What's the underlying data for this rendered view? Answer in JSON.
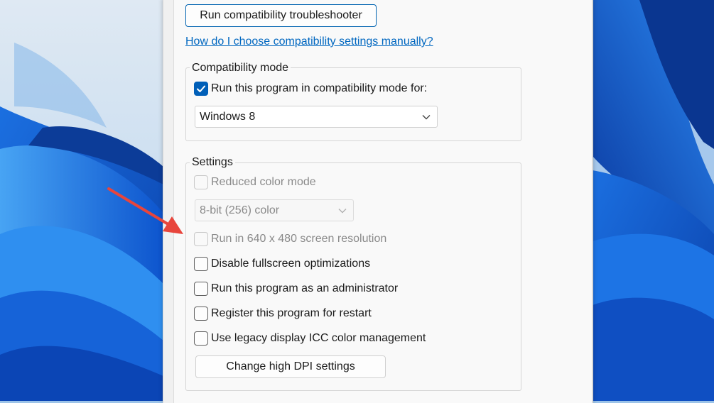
{
  "troubleshooter_button": "Run compatibility troubleshooter",
  "help_link": "How do I choose compatibility settings manually?",
  "compat_group": {
    "legend": "Compatibility mode",
    "checkbox_label": "Run this program in compatibility mode for:",
    "checked": true,
    "selected_os": "Windows 8"
  },
  "settings_group": {
    "legend": "Settings",
    "reduced_color": {
      "label": "Reduced color mode",
      "enabled": false,
      "checked": false
    },
    "color_select": "8-bit (256) color",
    "res_640": {
      "label": "Run in 640 x 480 screen resolution",
      "enabled": false,
      "checked": false
    },
    "fullscreen": {
      "label": "Disable fullscreen optimizations",
      "checked": false
    },
    "admin": {
      "label": "Run this program as an administrator",
      "checked": false
    },
    "restart": {
      "label": "Register this program for restart",
      "checked": false
    },
    "legacy_icc": {
      "label": "Use legacy display ICC color management",
      "checked": false
    },
    "dpi_button": "Change high DPI settings"
  },
  "colors": {
    "accent": "#005fb8",
    "link": "#0067c0",
    "annotation_arrow": "#e8453c"
  },
  "icons": [
    "check-icon",
    "chevron-down-icon",
    "annotation-arrow-icon"
  ]
}
